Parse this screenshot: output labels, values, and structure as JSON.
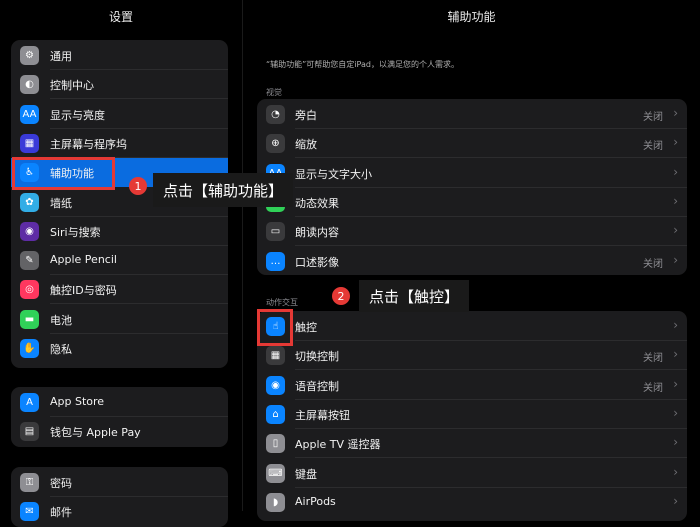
{
  "sidebar": {
    "title": "设置",
    "groups": [
      [
        {
          "label": "通用",
          "icon": "gear-icon",
          "color": "#8e8e93",
          "glyph": "⚙"
        },
        {
          "label": "控制中心",
          "icon": "toggles-icon",
          "color": "#8e8e93",
          "glyph": "◐"
        },
        {
          "label": "显示与亮度",
          "icon": "text-size-icon",
          "color": "#0a84ff",
          "glyph": "AA"
        },
        {
          "label": "主屏幕与程序坞",
          "icon": "home-grid-icon",
          "color": "#3a3ad8",
          "glyph": "▦"
        },
        {
          "label": "辅助功能",
          "icon": "accessibility-icon",
          "color": "#0a84ff",
          "glyph": "♿"
        },
        {
          "label": "墙纸",
          "icon": "wallpaper-icon",
          "color": "#32ade6",
          "glyph": "✿"
        },
        {
          "label": "Siri与搜索",
          "icon": "siri-icon",
          "color": "#5e2ca5",
          "glyph": "◉"
        },
        {
          "label": "Apple Pencil",
          "icon": "pencil-icon",
          "color": "#636366",
          "glyph": "✎"
        },
        {
          "label": "触控ID与密码",
          "icon": "fingerprint-icon",
          "color": "#ff375f",
          "glyph": "◎"
        },
        {
          "label": "电池",
          "icon": "battery-icon",
          "color": "#30d158",
          "glyph": "▬"
        },
        {
          "label": "隐私",
          "icon": "hand-icon",
          "color": "#0a84ff",
          "glyph": "✋"
        }
      ],
      [
        {
          "label": "App Store",
          "icon": "app-store-icon",
          "color": "#0a84ff",
          "glyph": "A"
        },
        {
          "label": "钱包与 Apple Pay",
          "icon": "wallet-icon",
          "color": "#3a3a3c",
          "glyph": "▤"
        }
      ],
      [
        {
          "label": "密码",
          "icon": "key-icon",
          "color": "#8e8e93",
          "glyph": "⚿"
        },
        {
          "label": "邮件",
          "icon": "mail-icon",
          "color": "#0a84ff",
          "glyph": "✉"
        }
      ]
    ]
  },
  "main": {
    "title": "辅助功能",
    "intro": "“辅助功能”可帮助您自定iPad，以满足您的个人需求。",
    "section_vision": "视觉",
    "vision_items": [
      {
        "label": "旁白",
        "value": "关闭",
        "icon": "voiceover-icon",
        "color": "#3a3a3c",
        "glyph": "◔"
      },
      {
        "label": "缩放",
        "value": "关闭",
        "icon": "zoom-icon",
        "color": "#3a3a3c",
        "glyph": "⊕"
      },
      {
        "label": "显示与文字大小",
        "value": "",
        "icon": "text-size-icon",
        "color": "#0a84ff",
        "glyph": "AA"
      },
      {
        "label": "动态效果",
        "value": "",
        "icon": "motion-icon",
        "color": "#30d158",
        "glyph": "◍"
      },
      {
        "label": "朗读内容",
        "value": "",
        "icon": "speech-bubble-icon",
        "color": "#3a3a3c",
        "glyph": "▭"
      },
      {
        "label": "口述影像",
        "value": "关闭",
        "icon": "audio-description-icon",
        "color": "#0a84ff",
        "glyph": "…"
      }
    ],
    "section_interaction": "动作交互",
    "interaction_items": [
      {
        "label": "触控",
        "value": "",
        "icon": "touch-hand-icon",
        "color": "#0a84ff",
        "glyph": "☝"
      },
      {
        "label": "切换控制",
        "value": "关闭",
        "icon": "switch-control-icon",
        "color": "#3a3a3c",
        "glyph": "▦"
      },
      {
        "label": "语音控制",
        "value": "关闭",
        "icon": "voice-control-icon",
        "color": "#0a84ff",
        "glyph": "◉"
      },
      {
        "label": "主屏幕按钮",
        "value": "",
        "icon": "home-button-icon",
        "color": "#0a84ff",
        "glyph": "⌂"
      },
      {
        "label": "Apple TV 遥控器",
        "value": "",
        "icon": "remote-icon",
        "color": "#8e8e93",
        "glyph": "▯"
      },
      {
        "label": "键盘",
        "value": "",
        "icon": "keyboard-icon",
        "color": "#8e8e93",
        "glyph": "⌨"
      },
      {
        "label": "AirPods",
        "value": "",
        "icon": "airpods-icon",
        "color": "#8e8e93",
        "glyph": "◗"
      }
    ]
  },
  "annotations": [
    {
      "number": "1",
      "text": "点击【辅助功能】"
    },
    {
      "number": "2",
      "text": "点击【触控】"
    }
  ]
}
